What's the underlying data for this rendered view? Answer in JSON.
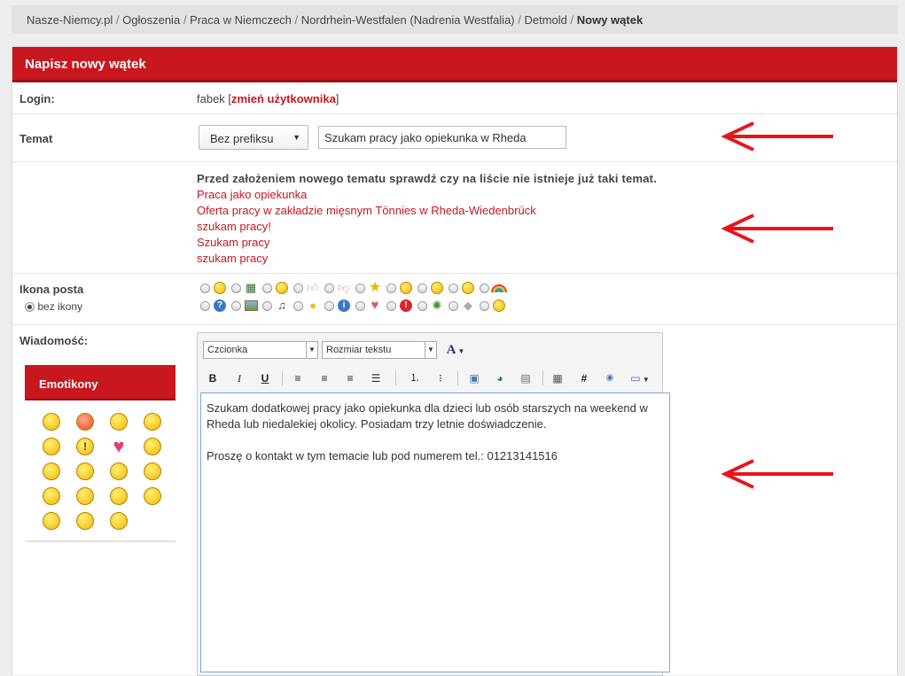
{
  "breadcrumb": {
    "items": [
      "Nasze-Niemcy.pl",
      "Ogłoszenia",
      "Praca w Niemczech",
      "Nordrhein-Westfalen (Nadrenia Westfalia)",
      "Detmold"
    ],
    "current": "Nowy wątek"
  },
  "panel": {
    "title": "Napisz nowy wątek"
  },
  "login": {
    "label": "Login:",
    "user": "fabek",
    "change_link": "zmień użytkownika"
  },
  "topic": {
    "label": "Temat",
    "prefix_selected": "Bez prefiksu",
    "value": "Szukam pracy jako opiekunka w Rheda"
  },
  "similar": {
    "warning": "Przed założeniem nowego tematu sprawdź czy na liście nie istnieje już taki temat.",
    "links": [
      "Praca jako opiekunka",
      "Oferta pracy w zakładzie mięsnym Tönnies w Rheda-Wiedenbrück",
      "szukam pracy!",
      "Szukam pracy",
      "szukam pracy"
    ]
  },
  "post_icon": {
    "label": "Ikona posta",
    "none_label": "bez ikony",
    "row1": [
      "smiley-icon",
      "film-icon",
      "tongue-icon",
      "thumbs-up-icon",
      "thumbs-down-icon",
      "star-icon",
      "smile-icon",
      "surprised-icon",
      "sad-icon",
      "rainbow-icon"
    ],
    "row2": [
      "question-icon",
      "picture-icon",
      "music-icon",
      "lightbulb-icon",
      "info-icon",
      "heart-icon",
      "exclamation-icon",
      "bug-icon",
      "cube-icon",
      "grin-icon"
    ]
  },
  "message": {
    "label": "Wiadomość:",
    "font_select": "Czcionka",
    "size_select": "Rozmiar tekstu",
    "text": "Szukam dodatkowej pracy jako opiekunka dla dzieci lub osób starszych na weekend w Rheda lub niedalekiej okolicy. Posiadam trzy letnie doświadczenie.\n\nProszę o kontakt w tym temacie lub pod numerem tel.: 01213141516"
  },
  "emoticons": {
    "title": "Emotikony"
  },
  "colors": {
    "accent": "#c8171e",
    "annotation_arrow": "#e8141c"
  }
}
